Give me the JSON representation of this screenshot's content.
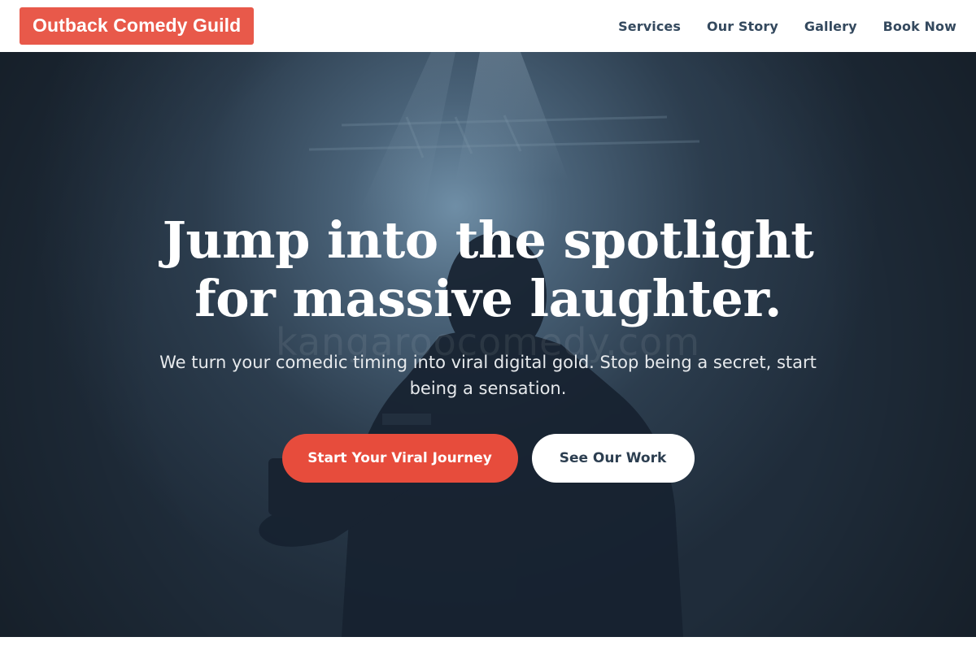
{
  "nav": {
    "brand": "Outback Comedy Guild",
    "links": [
      {
        "label": "Services"
      },
      {
        "label": "Our Story"
      },
      {
        "label": "Gallery"
      },
      {
        "label": "Book Now"
      }
    ]
  },
  "hero": {
    "title_line1": "Jump into the spotlight",
    "title_line2": "for massive laughter.",
    "subtitle": "We turn your comedic timing into viral digital gold. Stop being a secret, start being a sensation.",
    "watermark": "kangaroocomedy.com",
    "primary_button": "Start Your Viral Journey",
    "secondary_button": "See Our Work"
  },
  "colors": {
    "accent": "#e74c3c",
    "brand_bg": "#e8594a",
    "nav_text": "#34495e",
    "hero_overlay": "#22303f"
  }
}
